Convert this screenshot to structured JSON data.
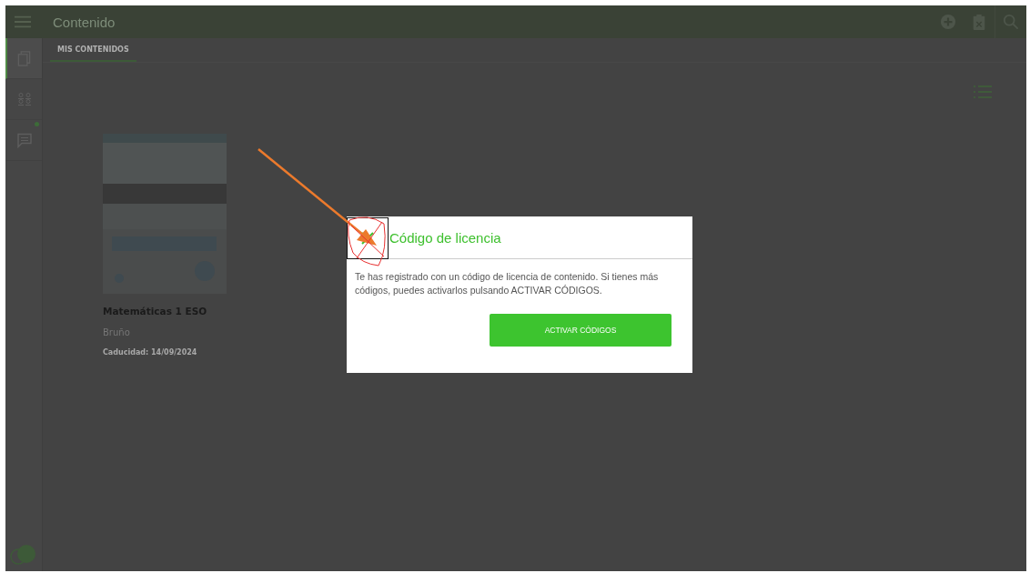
{
  "header": {
    "title": "Contenido"
  },
  "sidebar": {
    "items": [
      {
        "kind": "copies",
        "selected": true,
        "notification": false
      },
      {
        "kind": "people",
        "selected": false,
        "notification": false
      },
      {
        "kind": "chat",
        "selected": false,
        "notification": true
      }
    ]
  },
  "tabs": [
    {
      "label": "MIS CONTENIDOS",
      "selected": true
    }
  ],
  "books": [
    {
      "title": "Matemáticas 1 ESO",
      "publisher": "Bruño",
      "expiry": "Caducidad: 14/09/2024"
    }
  ],
  "dialog": {
    "title": "Código de licencia",
    "message": "Te has registrado con un código de licencia de contenido. Si tienes más códigos, puedes activarlos pulsando ACTIVAR CÓDIGOS.",
    "button": "ACTIVAR CÓDIGOS"
  }
}
